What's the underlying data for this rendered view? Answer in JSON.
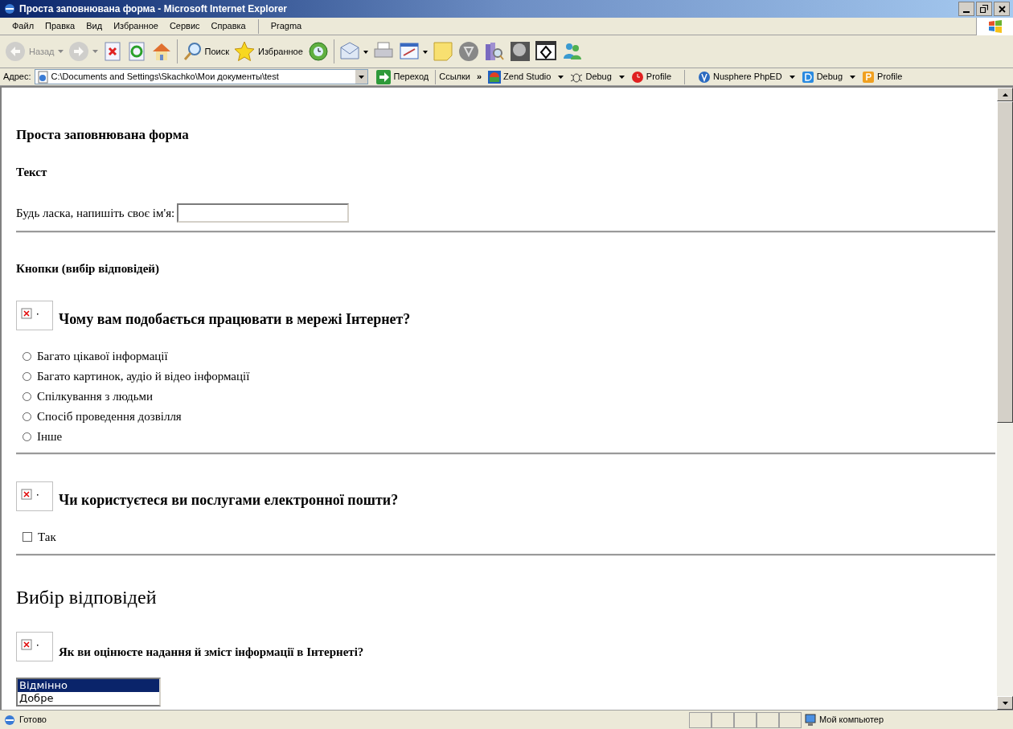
{
  "window": {
    "title": "Проста заповнювана форма - Microsoft Internet Explorer"
  },
  "menu": [
    {
      "label": "Файл"
    },
    {
      "label": "Правка"
    },
    {
      "label": "Вид"
    },
    {
      "label": "Избранное"
    },
    {
      "label": "Сервис"
    },
    {
      "label": "Справка"
    },
    {
      "label": "Pragma",
      "kind": "addon"
    }
  ],
  "toolbar": [
    {
      "kind": "back",
      "label": "Назад",
      "disabled": true
    },
    {
      "kind": "forward",
      "disabled": true
    },
    {
      "kind": "stop"
    },
    {
      "kind": "refresh"
    },
    {
      "kind": "home"
    },
    {
      "kind": "search",
      "label": "Поиск"
    },
    {
      "kind": "favorites",
      "label": "Избранное"
    },
    {
      "kind": "history"
    },
    {
      "kind": "mail"
    },
    {
      "kind": "print"
    },
    {
      "kind": "edit"
    },
    {
      "kind": "note"
    },
    {
      "kind": "messenger"
    },
    {
      "kind": "research"
    },
    {
      "kind": "tool"
    },
    {
      "kind": "window"
    },
    {
      "kind": "people"
    }
  ],
  "address": {
    "label": "Адрес:",
    "value": "C:\\Documents and Settings\\Skachko\\Мои документы\\test",
    "go": "Переход",
    "links": "Ссылки",
    "chevron": "»"
  },
  "link_items": [
    {
      "kind": "zend",
      "label": "Zend Studio",
      "dropdown": true
    },
    {
      "kind": "bug",
      "label": "Debug",
      "dropdown": true
    },
    {
      "kind": "clock",
      "label": "Profile",
      "dropdown": false
    },
    {
      "kind": "nusphere",
      "label": "Nusphere PhpED",
      "dropdown": true
    },
    {
      "kind": "dbg",
      "label": "Debug",
      "dropdown": true
    },
    {
      "kind": "profile",
      "label": "Profile",
      "dropdown": false
    }
  ],
  "page": [
    {
      "kind": "title",
      "text": "Проста заповнювана форма"
    },
    {
      "kind": "subheading",
      "text": "Текст"
    },
    {
      "kind": "text-field",
      "label": "Будь ласка, напишіть своє ім'я:"
    },
    {
      "kind": "rule"
    },
    {
      "kind": "subheading",
      "text": "Кнопки (вибір відповідей)"
    },
    {
      "kind": "question",
      "text": "Чому вам подобається працювати в мережі Інтернет?"
    },
    {
      "kind": "radio",
      "label": "Багато цікавої інформації",
      "selected": false
    },
    {
      "kind": "radio",
      "label": "Багато картинок, аудіо й відео інформації",
      "selected": false
    },
    {
      "kind": "radio",
      "label": "Спілкування з людьми",
      "selected": false
    },
    {
      "kind": "radio",
      "label": "Спосіб проведення дозвілля",
      "selected": false
    },
    {
      "kind": "radio",
      "label": "Інше",
      "selected": false
    },
    {
      "kind": "rule"
    },
    {
      "kind": "question",
      "text": "Чи користуєтеся ви послугами електронної пошти?"
    },
    {
      "kind": "checkbox",
      "label": "Так",
      "checked": false
    },
    {
      "kind": "rule"
    },
    {
      "kind": "heading",
      "text": "Вибір відповідей"
    },
    {
      "kind": "small-question",
      "text": "Як ви оцінюєте надання й зміст інформації в Інтернеті?"
    },
    {
      "kind": "listbox",
      "options": [
        {
          "label": "Відмінно",
          "selected": true
        },
        {
          "label": "Добре",
          "selected": false
        }
      ]
    }
  ],
  "status_bar": {
    "text": "Готово",
    "zone": "Мой компьютер"
  }
}
